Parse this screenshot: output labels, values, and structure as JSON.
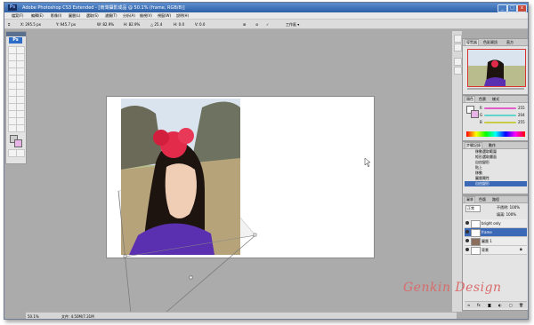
{
  "app": {
    "title": "Adobe Photoshop CS3 Extended - [南灣攝影成品 @ 50.1% (frame, RGB/8)]",
    "logo": "Ps"
  },
  "menu": [
    "檔案(F)",
    "編輯(E)",
    "影像(I)",
    "圖層(L)",
    "選取(S)",
    "濾鏡(T)",
    "分析(A)",
    "檢視(V)",
    "視窗(W)",
    "說明(H)"
  ],
  "options": {
    "x": "X: 295.5 px",
    "y": "Y: 945.7 px",
    "w": "W: 82.9%",
    "h": "H: 82.9%",
    "angle": "△ 25.4",
    "hskew": "H: 0.0",
    "vskew": "V: 0.0",
    "workspace": "工作區 ▾"
  },
  "status": {
    "zoom": "50.1%",
    "doc": "文件: 4.50M/7.31M"
  },
  "panels": {
    "navigator": {
      "tabs": [
        "導覽器",
        "色彩資訊",
        "直方"
      ]
    },
    "color": {
      "tabs": [
        "顏色",
        "色票",
        "樣式"
      ],
      "channels": [
        {
          "label": "R",
          "value": "255",
          "color": "#e05cc8"
        },
        {
          "label": "G",
          "value": "204",
          "color": "#5fd4cc"
        },
        {
          "label": "B",
          "value": "255",
          "color": "#c8cc45"
        }
      ]
    },
    "history": {
      "tabs": [
        "步驟記錄",
        "動作"
      ],
      "items": [
        "移動選取範圍",
        "矩形選取畫面",
        "自由變形",
        "貼上",
        "移動",
        "圖層屬性",
        "自由變形"
      ]
    },
    "layers": {
      "tabs": [
        "圖層",
        "色版",
        "路徑"
      ],
      "blend": "正常",
      "opacity": "不透明: 100%",
      "fill": "填滿: 100%",
      "rows": [
        {
          "name": "bright only",
          "selected": false
        },
        {
          "name": "frame",
          "selected": true
        },
        {
          "name": "圖層 1",
          "selected": false
        },
        {
          "name": "背景",
          "selected": false
        }
      ]
    }
  },
  "watermark": "Genkin Design",
  "colors": {
    "accent": "#3b69b5",
    "background": "#ababab",
    "foreground_swatch": "#cccccc",
    "background_swatch": "#e8b4e8"
  }
}
